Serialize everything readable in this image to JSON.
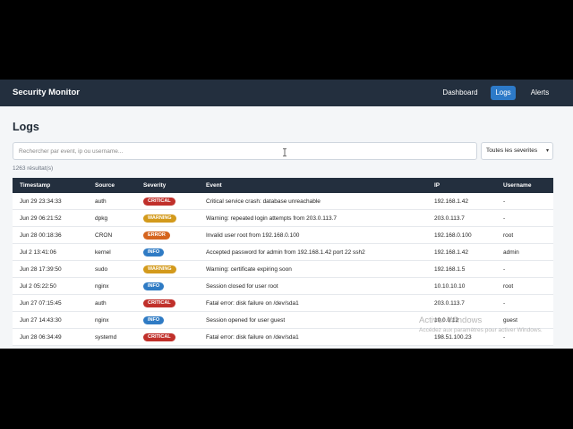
{
  "navbar": {
    "brand": "Security Monitor",
    "links": [
      {
        "label": "Dashboard",
        "active": false
      },
      {
        "label": "Logs",
        "active": true
      },
      {
        "label": "Alerts",
        "active": false
      }
    ]
  },
  "page": {
    "title": "Logs",
    "search_placeholder": "Rechercher par event, ip ou username...",
    "severity_filter": "Toutes les severites",
    "result_count": "1263 résultat(s)"
  },
  "table": {
    "columns": [
      "Timestamp",
      "Source",
      "Severity",
      "Event",
      "IP",
      "Username"
    ],
    "rows": [
      {
        "timestamp": "Jun 29 23:34:33",
        "source": "auth",
        "severity": "CRITICAL",
        "event": "Critical service crash: database unreachable",
        "ip": "192.168.1.42",
        "username": "-"
      },
      {
        "timestamp": "Jun 29 06:21:52",
        "source": "dpkg",
        "severity": "WARNING",
        "event": "Warning: repeated login attempts from 203.0.113.7",
        "ip": "203.0.113.7",
        "username": "-"
      },
      {
        "timestamp": "Jun 28 00:18:36",
        "source": "CRON",
        "severity": "ERROR",
        "event": "Invalid user root from 192.168.0.100",
        "ip": "192.168.0.100",
        "username": "root"
      },
      {
        "timestamp": "Jul 2 13:41:06",
        "source": "kernel",
        "severity": "INFO",
        "event": "Accepted password for admin from 192.168.1.42 port 22 ssh2",
        "ip": "192.168.1.42",
        "username": "admin"
      },
      {
        "timestamp": "Jun 28 17:39:50",
        "source": "sudo",
        "severity": "WARNING",
        "event": "Warning: certificate expiring soon",
        "ip": "192.168.1.5",
        "username": "-"
      },
      {
        "timestamp": "Jul 2 05:22:50",
        "source": "nginx",
        "severity": "INFO",
        "event": "Session closed for user root",
        "ip": "10.10.10.10",
        "username": "root"
      },
      {
        "timestamp": "Jun 27 07:15:45",
        "source": "auth",
        "severity": "CRITICAL",
        "event": "Fatal error: disk failure on /dev/sda1",
        "ip": "203.0.113.7",
        "username": "-"
      },
      {
        "timestamp": "Jun 27 14:43:30",
        "source": "nginx",
        "severity": "INFO",
        "event": "Session opened for user guest",
        "ip": "10.0.0.12",
        "username": "guest"
      },
      {
        "timestamp": "Jun 28 06:34:49",
        "source": "systemd",
        "severity": "CRITICAL",
        "event": "Fatal error: disk failure on /dev/sda1",
        "ip": "198.51.100.23",
        "username": "-"
      }
    ]
  },
  "severity_colors": {
    "CRITICAL": "#c0302b",
    "WARNING": "#d39a1c",
    "ERROR": "#d5641e",
    "INFO": "#2f7bc4"
  },
  "watermark": {
    "title": "Activer Windows",
    "subtitle": "Accédez aux paramètres pour activer Windows."
  },
  "icons": {
    "text_cursor": "text-cursor-icon",
    "select_chevron": "chevron-down-icon"
  }
}
